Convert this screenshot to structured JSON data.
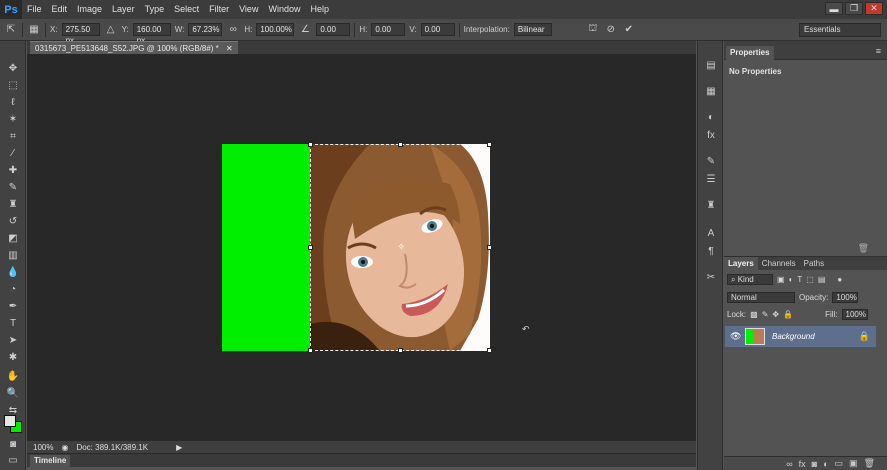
{
  "app": {
    "logo": "Ps"
  },
  "menu": [
    "File",
    "Edit",
    "Image",
    "Layer",
    "Type",
    "Select",
    "Filter",
    "View",
    "Window",
    "Help"
  ],
  "window_controls": {
    "minimize": "▬",
    "restore": "❐",
    "close": "✕"
  },
  "options": {
    "x_label": "X:",
    "x_value": "275.50 px",
    "y_label": "Y:",
    "y_value": "160.00 px",
    "w_label": "W:",
    "w_value": "67.23%",
    "h_label": "H:",
    "h_value": "100.00%",
    "angle_value": "0.00",
    "hskew_label": "H:",
    "hskew_value": "0.00",
    "vskew_label": "V:",
    "vskew_value": "0.00",
    "interpolation_label": "Interpolation:",
    "interpolation_value": "Bilinear",
    "workspace": "Essentials"
  },
  "document": {
    "tab_title": "0315673_PE513648_S52.JPG @ 100% (RGB/8#) *",
    "zoom": "100%",
    "doc_size": "Doc: 389.1K/389.1K"
  },
  "timeline": {
    "label": "Timeline"
  },
  "properties": {
    "tab": "Properties",
    "empty_text": "No Properties"
  },
  "layers": {
    "tabs": [
      "Layers",
      "Channels",
      "Paths"
    ],
    "filter_kind": "Kind",
    "blend_mode": "Normal",
    "opacity_label": "Opacity:",
    "opacity_value": "100%",
    "lock_label": "Lock:",
    "fill_label": "Fill:",
    "fill_value": "100%",
    "layer_name": "Background"
  },
  "colors": {
    "green_fill": "#00ee00",
    "canvas_bg": "#282828",
    "layer_selected": "#5e6f8e"
  }
}
